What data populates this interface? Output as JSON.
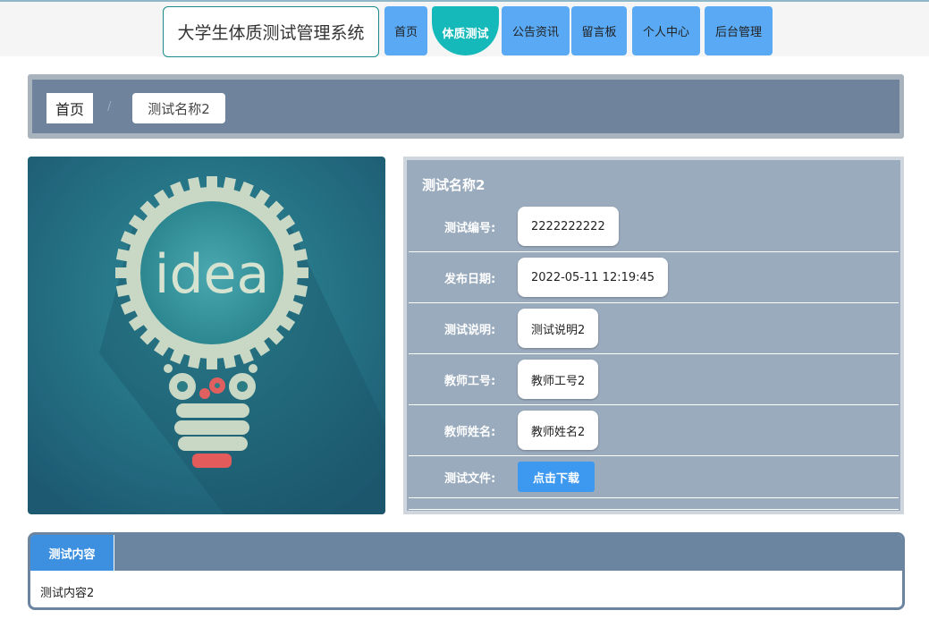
{
  "header": {
    "brand": "大学生体质测试管理系统",
    "nav": [
      {
        "label": "首页"
      },
      {
        "label": "体质测试"
      },
      {
        "label": "公告资讯"
      },
      {
        "label": "留言板"
      },
      {
        "label": "个人中心"
      },
      {
        "label": "后台管理"
      }
    ],
    "active_index": 1
  },
  "breadcrumb": {
    "home": "首页",
    "separator": "/",
    "current": "测试名称2"
  },
  "hero_image": {
    "text": "idea"
  },
  "detail": {
    "title": "测试名称2",
    "rows": [
      {
        "label": "测试编号:",
        "value": "2222222222"
      },
      {
        "label": "发布日期:",
        "value": "2022-05-11 12:19:45"
      },
      {
        "label": "测试说明:",
        "value": "测试说明2"
      },
      {
        "label": "教师工号:",
        "value": "教师工号2"
      },
      {
        "label": "教师姓名:",
        "value": "教师姓名2"
      },
      {
        "label": "测试文件:",
        "button": "点击下载"
      }
    ]
  },
  "content_tab": {
    "tab_label": "测试内容",
    "body": "测试内容2"
  },
  "colors": {
    "nav_bg": "#5aa9f4",
    "nav_active": "#15b9b9",
    "crumb_bg": "#6f849c",
    "panel_bg": "#9aabbd",
    "download_btn": "#3d98f0"
  }
}
